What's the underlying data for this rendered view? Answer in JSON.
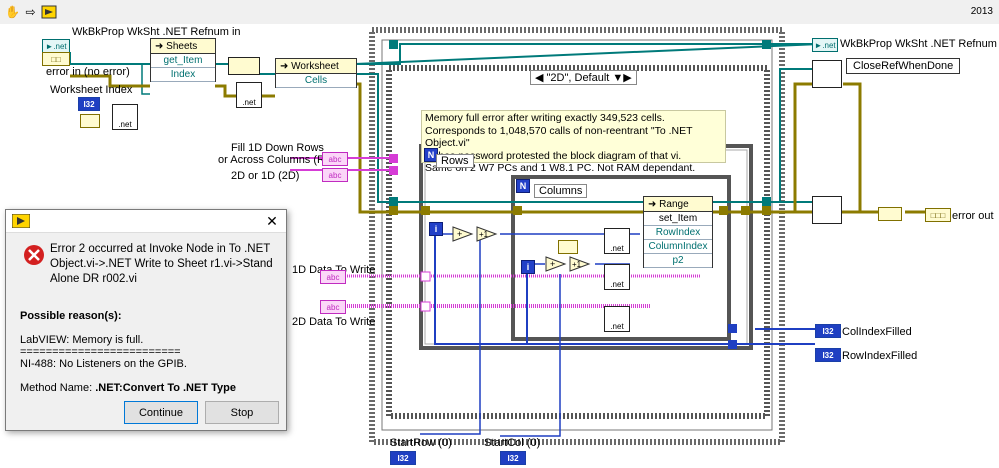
{
  "toolbar": {
    "year": "2013",
    "icons": [
      "hand-icon",
      "run-arrow-icon",
      "wrap-icon"
    ]
  },
  "labels": {
    "refnum_in": "WkBkProp WkSht .NET Refnum in",
    "error_in": "error in (no error)",
    "worksheet_index": "Worksheet Index",
    "fill_1d_line1": "Fill 1D Down Rows",
    "fill_1d_line2": "or Across Columns (R)",
    "two_d_or_one_d": "2D or 1D (2D)",
    "one_d_data": "1D Data To Write",
    "two_d_data": "2D Data To Write",
    "refnum_out": "WkBkProp WkSht .NET Refnum out",
    "close_ref": "CloseRefWhenDone",
    "error_out": "error out",
    "col_index_filled": "ColIndexFilled",
    "row_index_filled": "RowIndexFilled",
    "start_row": "StartRow (0)",
    "start_col": "StartCol (0)"
  },
  "terminals": {
    "i32": "I32",
    "abc": "abc",
    "net": ".net",
    "tf": "TF",
    "err": "err"
  },
  "nodes": {
    "sheets": {
      "title": "Sheets",
      "method": "get_Item",
      "param": "Index"
    },
    "worksheet": {
      "title": "Worksheet",
      "prop": "Cells"
    },
    "range": {
      "title": "Range",
      "method": "set_Item",
      "params": [
        "RowIndex",
        "ColumnIndex",
        "p2"
      ]
    }
  },
  "case_selector": "\"2D\", Default",
  "loops": {
    "rows_label": "Rows",
    "columns_label": "Columns",
    "n": "N",
    "i": "i",
    "plus_one": "+1"
  },
  "comment": {
    "line1": "Memory full error after writing exactly 349,523 cells.",
    "line2": "Corresponds to 1,048,570 calls of non-reentrant \"To .NET Object.vi\"",
    "line3": "NI has password protested the block diagram of that vi.",
    "line4": "Same on 2 W7 PCs and 1 W8.1 PC.  Not RAM dependant."
  },
  "dialog": {
    "error_line1": "Error 2 occurred at Invoke Node in To .NET",
    "error_line2": "Object.vi->.NET Write to Sheet r1.vi->Stand",
    "error_line3": "Alone DR r002.vi",
    "possible_reasons": "Possible reason(s):",
    "reason1": "LabVIEW:  Memory is full.",
    "separator": "=========================",
    "reason2": "NI-488:  No Listeners on the GPIB.",
    "method_prefix": "Method Name: ",
    "method_name": ".NET:Convert To .NET Type",
    "continue_button": "Continue",
    "stop_button": "Stop"
  },
  "colors": {
    "wire_ref": "#007a7a",
    "wire_error": "#8c7b00",
    "wire_string": "#d63cd6",
    "wire_int": "#1f3fc2",
    "error_icon": "#d32020"
  }
}
